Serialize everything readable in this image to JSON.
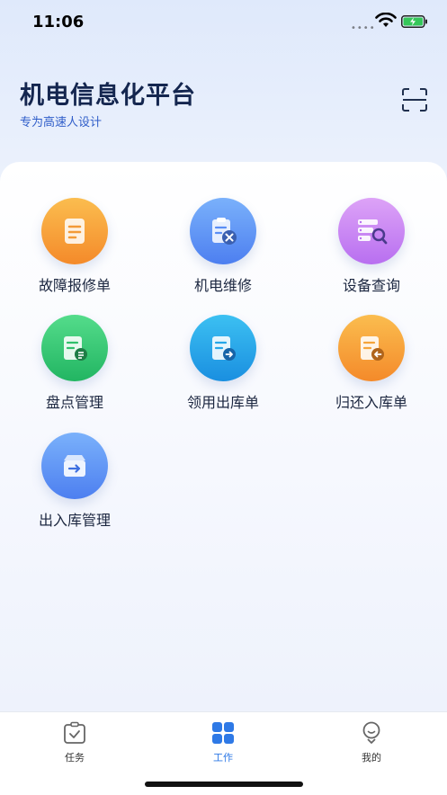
{
  "status_bar": {
    "time": "11:06"
  },
  "header": {
    "title": "机电信息化平台",
    "subtitle": "专为高速人设计",
    "scan_icon": "scan-icon"
  },
  "grid": [
    {
      "label": "故障报修单",
      "icon": "document-icon",
      "color": "#f7a036"
    },
    {
      "label": "机电维修",
      "icon": "repair-clipboard-icon",
      "color": "#5a8ef5"
    },
    {
      "label": "设备查询",
      "icon": "device-search-icon",
      "color": "#c77ff0"
    },
    {
      "label": "盘点管理",
      "icon": "inventory-icon",
      "color": "#35c76f"
    },
    {
      "label": "领用出库单",
      "icon": "stock-out-icon",
      "color": "#25a6e8"
    },
    {
      "label": "归还入库单",
      "icon": "stock-return-icon",
      "color": "#f5a43a"
    },
    {
      "label": "出入库管理",
      "icon": "in-out-box-icon",
      "color": "#5b8ff0"
    }
  ],
  "tabbar": {
    "tabs": [
      {
        "label": "任务",
        "icon": "task-icon",
        "active": false
      },
      {
        "label": "工作",
        "icon": "grid-apps-icon",
        "active": true
      },
      {
        "label": "我的",
        "icon": "profile-icon",
        "active": false
      }
    ],
    "active_color": "#2e79e6"
  }
}
